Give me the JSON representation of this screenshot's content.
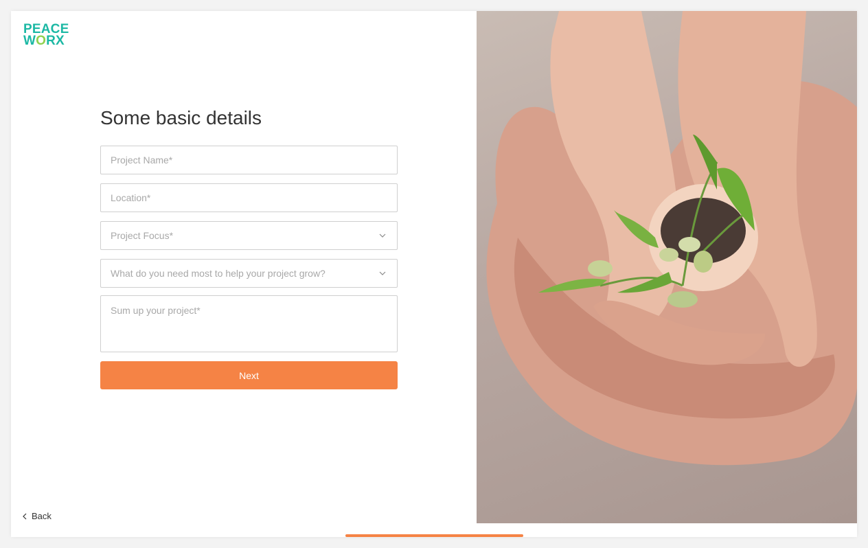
{
  "brand": {
    "logo_line1": "PEACE",
    "logo_line2_a": "W",
    "logo_line2_o": "O",
    "logo_line2_b": "RX"
  },
  "form": {
    "title": "Some basic details",
    "project_name_placeholder": "Project Name*",
    "location_placeholder": "Location*",
    "project_focus_placeholder": "Project Focus*",
    "needs_placeholder": "What do you need most to help your project grow?",
    "summary_placeholder": "Sum up your project*",
    "next_label": "Next"
  },
  "nav": {
    "back_label": "Back"
  },
  "progress": {
    "fraction": 0.33
  },
  "colors": {
    "accent": "#f58345",
    "brand_teal": "#1cb8a4",
    "brand_green": "#8fd14f"
  },
  "icons": {
    "select_arrow": "chevron-down-icon",
    "back_arrow": "chevron-left-icon"
  }
}
